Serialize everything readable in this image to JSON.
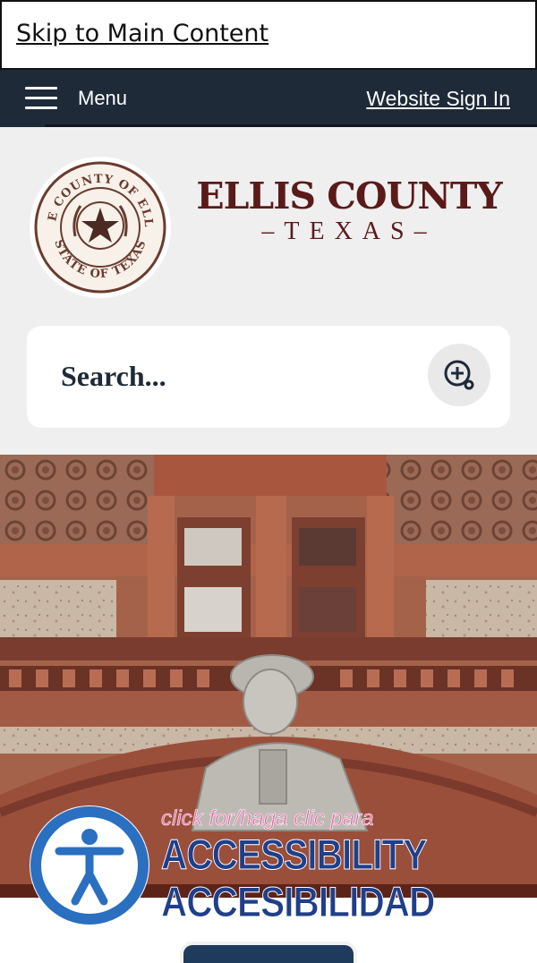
{
  "skip_link": {
    "label": "Skip to Main Content"
  },
  "nav": {
    "menu_label": "Menu",
    "sign_in_label": "Website Sign In"
  },
  "brand": {
    "title": "ELLIS COUNTY",
    "subtitle": "–TEXAS–",
    "seal": {
      "top_text": "THE COUNTY OF ELLIS",
      "bottom_text": "STATE OF TEXAS"
    }
  },
  "search": {
    "placeholder": "Search...",
    "icon": "search-plus-icon"
  },
  "banner": {
    "description_icon": "courthouse-statue-image",
    "accessibility": {
      "small_text": "click for/haga clic para",
      "line1": "ACCESSIBILITY",
      "line2": "ACCESIBILIDAD",
      "icon": "accessibility-person-icon"
    }
  },
  "colors": {
    "nav_bg": "#1e2a38",
    "brand_maroon": "#5b1a1a",
    "header_bg": "#efefef",
    "accessibility_blue": "#1f3f8a",
    "accessibility_pink": "#e56aa8"
  }
}
